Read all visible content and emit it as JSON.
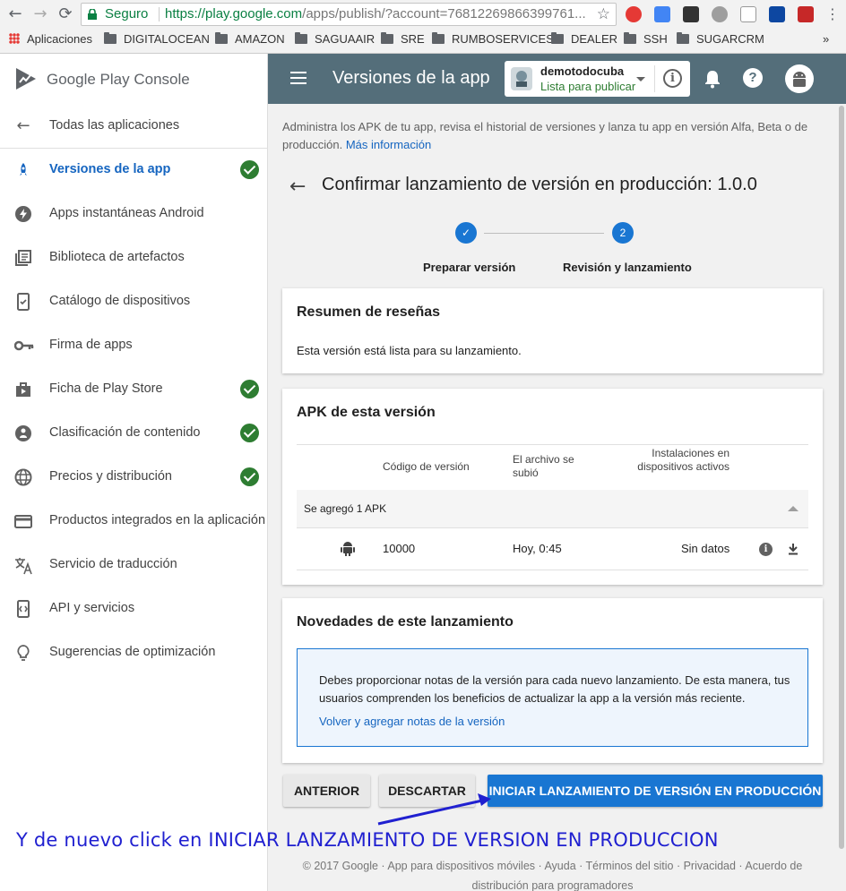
{
  "browser": {
    "secure_label": "Seguro",
    "url_host": "https://play.google.com",
    "url_path": "/apps/publish/?account=76812269866399761...",
    "bookmarks": [
      "Aplicaciones",
      "DIGITALOCEAN",
      "AMAZON",
      "SAGUAAIR",
      "SRE",
      "RUMBOSERVICES",
      "DEALER",
      "SSH",
      "SUGARCRM"
    ],
    "more_bookmarks": "»"
  },
  "sidebar": {
    "brand": "Google Play Console",
    "back_label": "Todas las aplicaciones",
    "items": [
      {
        "label": "Versiones de la app",
        "icon": "rocket-icon",
        "checked": true,
        "active": true
      },
      {
        "label": "Apps instantáneas Android",
        "icon": "bolt-icon",
        "checked": false
      },
      {
        "label": "Biblioteca de artefactos",
        "icon": "library-icon",
        "checked": false
      },
      {
        "label": "Catálogo de dispositivos",
        "icon": "device-icon",
        "checked": false
      },
      {
        "label": "Firma de apps",
        "icon": "key-icon",
        "checked": false
      },
      {
        "label": "Ficha de Play Store",
        "icon": "store-listing-icon",
        "checked": true
      },
      {
        "label": "Clasificación de contenido",
        "icon": "content-rating-icon",
        "checked": true
      },
      {
        "label": "Precios y distribución",
        "icon": "globe-icon",
        "checked": true
      },
      {
        "label": "Productos integrados en la aplicación",
        "icon": "card-icon",
        "checked": false
      },
      {
        "label": "Servicio de traducción",
        "icon": "translate-icon",
        "checked": false
      },
      {
        "label": "API y servicios",
        "icon": "api-icon",
        "checked": false
      },
      {
        "label": "Sugerencias de optimización",
        "icon": "lightbulb-icon",
        "checked": false
      }
    ]
  },
  "appbar": {
    "title": "Versiones de la app",
    "app_name": "demotodocuba",
    "app_status": "Lista para publicar"
  },
  "main": {
    "intro_text": "Administra los APK de tu app, revisa el historial de versiones y lanza tu app en versión Alfa, Beta o de producción.",
    "intro_link": "Más información",
    "page_title": "Confirmar lanzamiento de versión en producción: 1.0.0",
    "steps": [
      {
        "label": "Preparar versión",
        "marker": "✓"
      },
      {
        "label": "Revisión y lanzamiento",
        "marker": "2"
      }
    ],
    "review_summary": {
      "title": "Resumen de reseñas",
      "text": "Esta versión está lista para su lanzamiento."
    },
    "apk_card": {
      "title": "APK de esta versión",
      "headers": [
        "Código de versión",
        "El archivo se subió",
        "Instalaciones en dispositivos activos"
      ],
      "group_label": "Se agregó 1 APK",
      "rows": [
        {
          "version_code": "10000",
          "uploaded": "Hoy, 0:45",
          "installs": "Sin datos"
        }
      ]
    },
    "whats_new": {
      "title": "Novedades de este lanzamiento",
      "notice": "Debes proporcionar notas de la versión para cada nuevo lanzamiento. De esta manera, tus usuarios comprenden los beneficios de actualizar la app a la versión más reciente.",
      "notice_link": "Volver y agregar notas de la versión"
    },
    "buttons": {
      "previous": "ANTERIOR",
      "discard": "DESCARTAR",
      "start_rollout": "INICIAR LANZAMIENTO DE VERSIÓN EN PRODUCCIÓN"
    },
    "footer": "© 2017 Google · App para dispositivos móviles · Ayuda · Términos del sitio · Privacidad · Acuerdo de distribución para programadores"
  },
  "annotation": {
    "text": "Y de nuevo click en INICIAR LANZAMIENTO DE VERSION EN PRODUCCION",
    "color": "#2020d0"
  },
  "colors": {
    "appbar": "#546e7a",
    "primary": "#1976d2",
    "check_green": "#2e7d32",
    "link": "#1565c0"
  }
}
